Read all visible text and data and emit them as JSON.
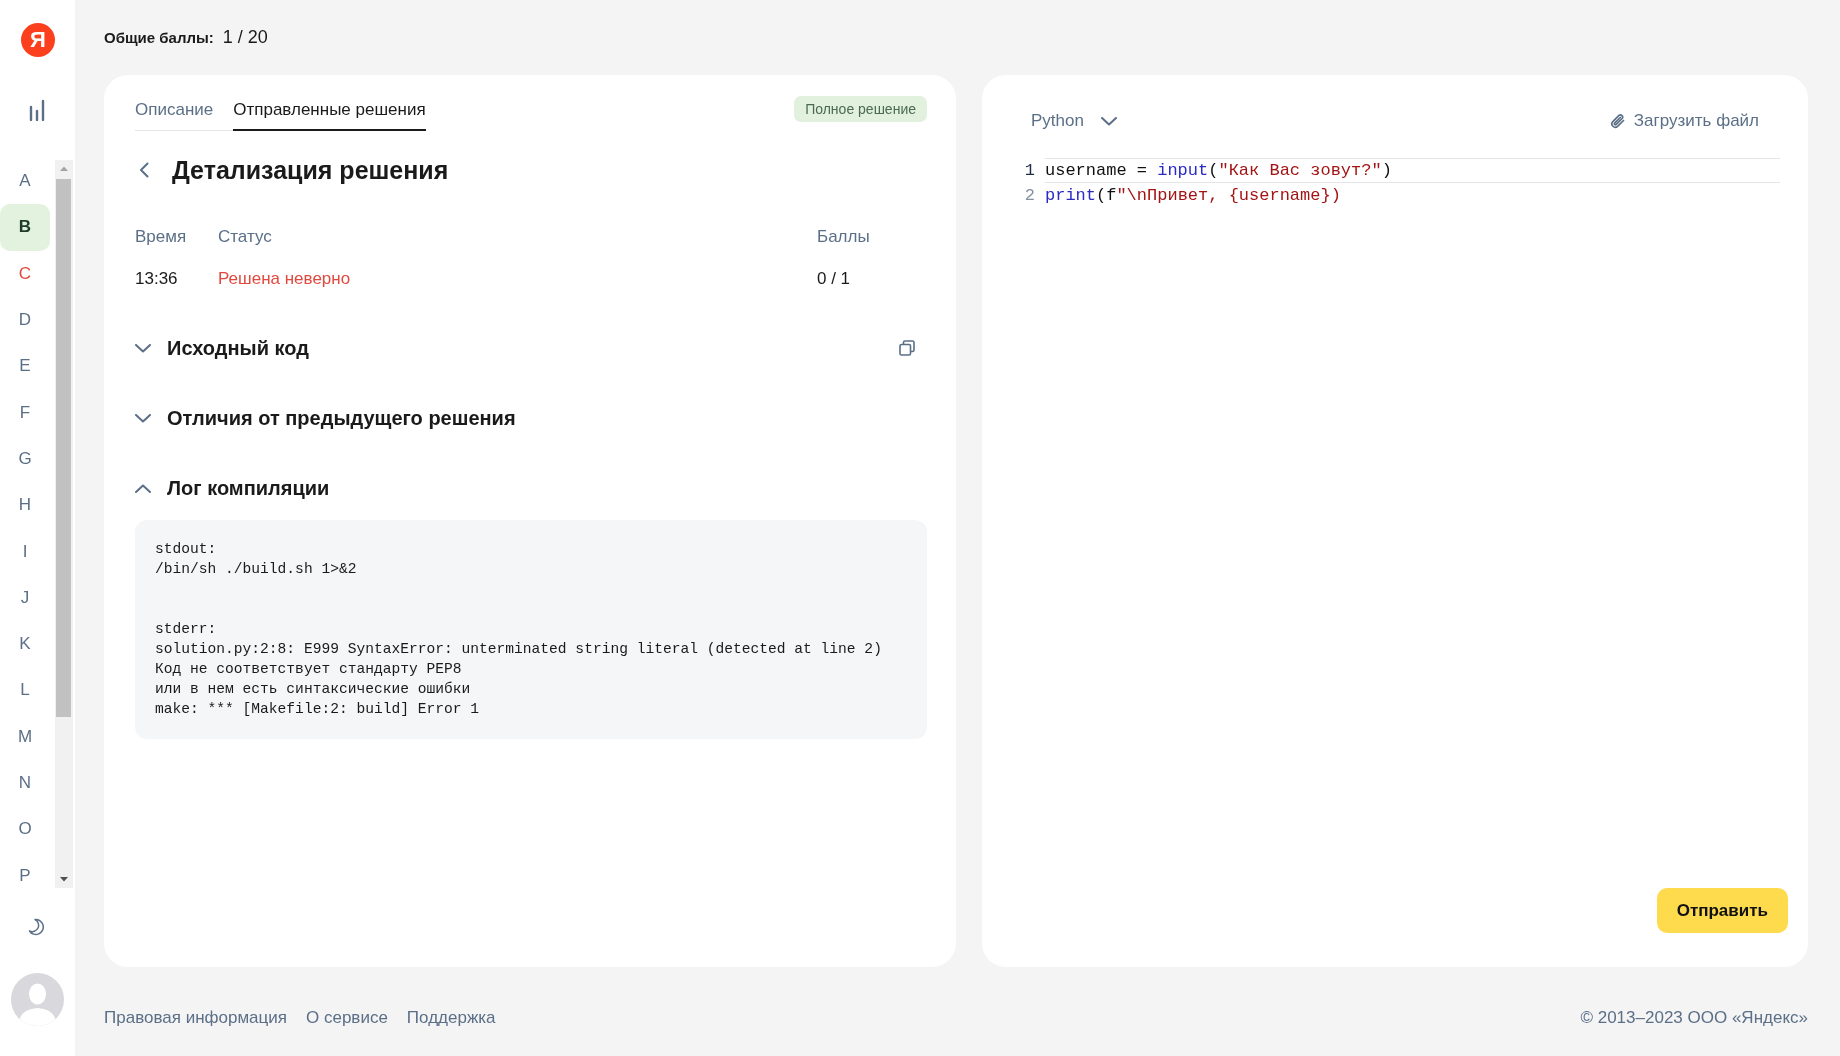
{
  "sidebar": {
    "logo": "Я",
    "letters": [
      {
        "label": "A",
        "selected": false,
        "failed": false
      },
      {
        "label": "B",
        "selected": true,
        "failed": false
      },
      {
        "label": "C",
        "selected": false,
        "failed": true
      },
      {
        "label": "D",
        "selected": false,
        "failed": false
      },
      {
        "label": "E",
        "selected": false,
        "failed": false
      },
      {
        "label": "F",
        "selected": false,
        "failed": false
      },
      {
        "label": "G",
        "selected": false,
        "failed": false
      },
      {
        "label": "H",
        "selected": false,
        "failed": false
      },
      {
        "label": "I",
        "selected": false,
        "failed": false
      },
      {
        "label": "J",
        "selected": false,
        "failed": false
      },
      {
        "label": "K",
        "selected": false,
        "failed": false
      },
      {
        "label": "L",
        "selected": false,
        "failed": false
      },
      {
        "label": "M",
        "selected": false,
        "failed": false
      },
      {
        "label": "N",
        "selected": false,
        "failed": false
      },
      {
        "label": "O",
        "selected": false,
        "failed": false
      },
      {
        "label": "P",
        "selected": false,
        "failed": false
      }
    ]
  },
  "header": {
    "label": "Общие баллы:",
    "value": "1 / 20"
  },
  "task_panel": {
    "tabs": [
      {
        "label": "Описание",
        "selected": false
      },
      {
        "label": "Отправленные решения",
        "selected": true
      }
    ],
    "badge": "Полное решение",
    "title": "Детализация решения",
    "table": {
      "columns": [
        "Время",
        "Статус",
        "Баллы"
      ],
      "rows": [
        {
          "time": "13:36",
          "status": "Решена неверно",
          "failed": true,
          "score": "0 / 1"
        }
      ]
    },
    "sections": [
      {
        "title": "Исходный код",
        "expanded": false,
        "copyable": true
      },
      {
        "title": "Отличия от предыдущего решения",
        "expanded": false,
        "copyable": false
      },
      {
        "title": "Лог компиляции",
        "expanded": true,
        "copyable": false,
        "log": [
          {
            "lines": [
              "stdout:",
              "/bin/sh ./build.sh 1>&2"
            ]
          },
          {
            "lines": [
              "stderr:",
              "solution.py:2:8: E999 SyntaxError: unterminated string literal (detected at line 2)",
              "Код не соответствует стандарту PEP8",
              "или в нем есть синтаксические ошибки",
              "make: *** [Makefile:2: build] Error 1"
            ]
          }
        ]
      }
    ]
  },
  "editor": {
    "language": "Python",
    "upload": "Загрузить файл",
    "lines": [
      {
        "number": "1",
        "active": true,
        "tokens": [
          {
            "text": "username = ",
            "kind": "plain"
          },
          {
            "text": "input",
            "kind": "builtin"
          },
          {
            "text": "(",
            "kind": "plain"
          },
          {
            "text": "\"Как Вас зовут?\"",
            "kind": "string"
          },
          {
            "text": ")",
            "kind": "plain"
          }
        ]
      },
      {
        "number": "2",
        "active": false,
        "tokens": [
          {
            "text": "print",
            "kind": "builtin"
          },
          {
            "text": "(f",
            "kind": "plain"
          },
          {
            "text": "\"\\nПривет, {username})",
            "kind": "string"
          }
        ]
      }
    ],
    "submit": "Отправить"
  },
  "footer": {
    "links": [
      "Правовая информация",
      "О сервисе",
      "Поддержка"
    ],
    "copyright": "© 2013–2023 ООО «Яндекс»"
  }
}
